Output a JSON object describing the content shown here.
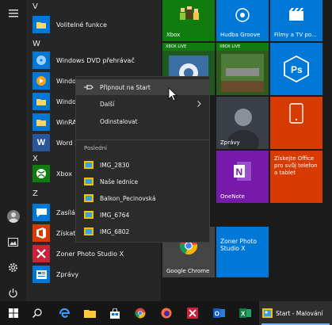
{
  "app_list": {
    "sections": [
      {
        "letter": "V",
        "apps": [
          {
            "label": "Volitelné funkce",
            "icon": "folder-icon"
          }
        ]
      },
      {
        "letter": "W",
        "apps": [
          {
            "label": "Windows DVD přehrávač",
            "icon": "dvd-icon"
          },
          {
            "label": "Windows",
            "icon": "windows-media-icon"
          },
          {
            "label": "Windows",
            "icon": "folder-icon"
          },
          {
            "label": "WinRAR",
            "icon": "folder-icon"
          },
          {
            "label": "Word 20",
            "icon": "word-icon"
          }
        ]
      },
      {
        "letter": "X",
        "apps": [
          {
            "label": "Xbox",
            "icon": "xbox-icon"
          }
        ]
      },
      {
        "letter": "Z",
        "apps": [
          {
            "label": "Zasílání",
            "icon": "messaging-icon"
          },
          {
            "label": "Získat O",
            "icon": "office-icon"
          },
          {
            "label": "Zoner Photo Studio X",
            "icon": "zoner-icon"
          },
          {
            "label": "Zprávy",
            "icon": "news-icon"
          }
        ]
      }
    ]
  },
  "context_menu": {
    "pin_label": "Připnout na Start",
    "more_label": "Další",
    "uninstall_label": "Odinstalovat",
    "recent_header": "Poslední",
    "recent_items": [
      "IMG_2830",
      "Naše lednice",
      "Balkon_Pecinovská",
      "IMG_6764",
      "IMG_6802"
    ]
  },
  "tiles": {
    "xbox": "Xbox",
    "groove": "Hudba Groove",
    "movies": "Filmy a TV po...",
    "xbox_live": "XBOX LIVE",
    "news": "Zprávy",
    "office_promo": "Získejte Office pro svůj telefon a tablet",
    "onenote": "OneNote",
    "chrome": "Google Chrome",
    "zoner": "Zoner Photo Studio X"
  },
  "taskbar": {
    "active_window_label": "Start - Malování"
  },
  "colors": {
    "tile_blue": "#0078d7",
    "xbox_green": "#107c10",
    "office_red": "#d83b01",
    "onenote_purple": "#7719aa"
  }
}
